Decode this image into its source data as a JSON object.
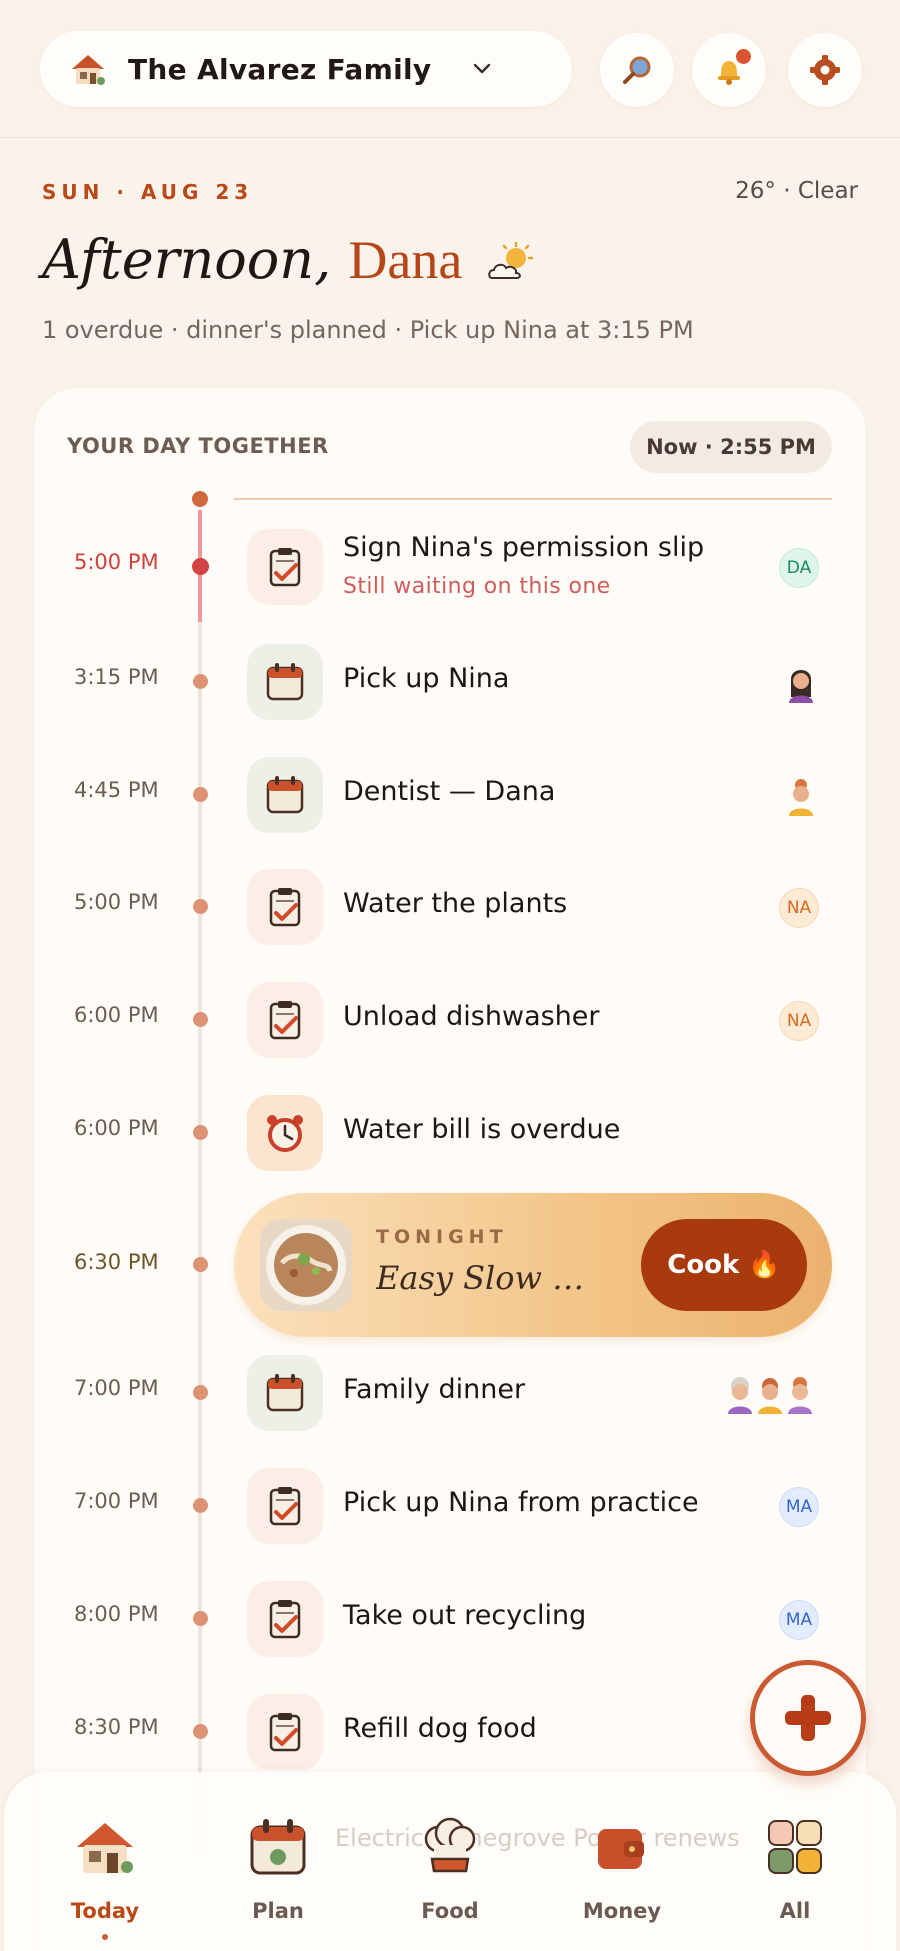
{
  "header": {
    "family_name": "The Alvarez Family",
    "icons": [
      "house-icon",
      "chevron-down-icon",
      "search-icon",
      "bell-icon",
      "gear-icon"
    ]
  },
  "greeting": {
    "date": "SUN · AUG 23",
    "weather": "26° · Clear",
    "salutation": "Afternoon,",
    "name": "Dana",
    "summary": "1 overdue · dinner's planned · Pick up Nina at 3:15 PM"
  },
  "day": {
    "title": "YOUR DAY TOGETHER",
    "now": "Now · 2:55 PM",
    "items": [
      {
        "time": "5:00 PM",
        "title": "Sign Nina's permission slip",
        "sub": "Still waiting on this one",
        "icon": "clipboard-icon",
        "assignee": "DA",
        "overdue": true
      },
      {
        "time": "3:15 PM",
        "title": "Pick up Nina",
        "icon": "calendar-icon",
        "assignee_avatar": "girl-avatar"
      },
      {
        "time": "4:45 PM",
        "title": "Dentist — Dana",
        "icon": "calendar-icon",
        "assignee_avatar": "woman-avatar"
      },
      {
        "time": "5:00 PM",
        "title": "Water the plants",
        "icon": "clipboard-icon",
        "assignee": "NA"
      },
      {
        "time": "6:00 PM",
        "title": "Unload dishwasher",
        "icon": "clipboard-icon",
        "assignee": "NA"
      },
      {
        "time": "6:00 PM",
        "title": "Water bill is overdue",
        "icon": "alarm-clock-icon"
      },
      {
        "time": "7:00 PM",
        "title": "Family dinner",
        "icon": "calendar-icon",
        "assignee_avatars": [
          "grandma-avatar",
          "man-avatar",
          "woman-avatar"
        ]
      },
      {
        "time": "7:00 PM",
        "title": "Pick up Nina from practice",
        "icon": "clipboard-icon",
        "assignee": "MA"
      },
      {
        "time": "8:00 PM",
        "title": "Take out recycling",
        "icon": "clipboard-icon",
        "assignee": "MA"
      },
      {
        "time": "8:30 PM",
        "title": "Refill dog food",
        "icon": "clipboard-icon"
      }
    ],
    "dinner": {
      "time": "6:30 PM",
      "label": "TONIGHT",
      "recipe": "Easy Slow Co…",
      "button": "Cook 🔥"
    }
  },
  "ticker": "Electric · Pinegrove Power renews",
  "nav": [
    {
      "label": "Today",
      "active": true
    },
    {
      "label": "Plan"
    },
    {
      "label": "Food"
    },
    {
      "label": "Money"
    },
    {
      "label": "All"
    }
  ],
  "colors": {
    "background": "#faf3ec",
    "accent": "#b94a17",
    "overdue": "#d0413d",
    "cook_button": "#a83a0e"
  }
}
